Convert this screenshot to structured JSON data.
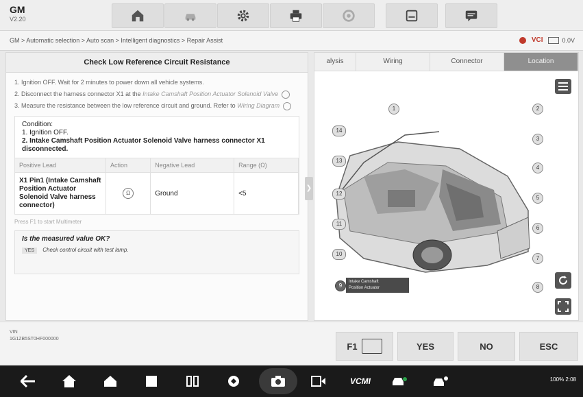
{
  "app": {
    "brand": "GM",
    "version": "V2.20"
  },
  "toolbar": {
    "icons": [
      "home-icon",
      "vehicle-icon",
      "gear-icon",
      "print-icon",
      "help-icon",
      "save-icon",
      "chat-icon"
    ]
  },
  "breadcrumb": {
    "text": "GM > Automatic selection > Auto scan > Intelligent diagnostics > Repair Assist"
  },
  "status_bar": {
    "vci_label": "VCI",
    "voltage": "0.0V"
  },
  "left": {
    "title": "Check Low Reference Circuit Resistance",
    "steps": [
      {
        "text": "1. Ignition OFF. Wait for 2 minutes to power down all vehicle systems."
      },
      {
        "text": "2. Disconnect the harness connector X1 at the",
        "link": "Intake Camshaft Position Actuator Solenoid Valve"
      },
      {
        "text": "3. Measure the resistance between the low reference circuit and ground. Refer to",
        "link": "Wiring Diagram"
      }
    ],
    "condition_label": "Condition:",
    "condition_1": "1. Ignition OFF.",
    "condition_2": "2. Intake Camshaft Position Actuator Solenoid Valve harness connector X1 disconnected.",
    "table": {
      "headers": [
        "Positive Lead",
        "Action",
        "Negative Lead",
        "Range (Ω)"
      ],
      "row": {
        "positive": "X1 Pin1 (Intake Camshaft Position Actuator Solenoid Valve harness connector)",
        "action": "Ω",
        "negative": "Ground",
        "range": "<5"
      }
    },
    "hint": "Press F1 to start Multimeter",
    "question": "Is the measured value OK?",
    "answer_tag": "YES",
    "answer_text": "Check control circuit with test lamp."
  },
  "right": {
    "tabs": [
      "alysis",
      "Wiring",
      "Connector",
      "Location"
    ],
    "active_tab": "Location",
    "callouts": [
      "1",
      "2",
      "3",
      "4",
      "5",
      "6",
      "7",
      "8",
      "9",
      "10",
      "11",
      "12",
      "13",
      "14"
    ],
    "component_label_1": "Intake Camshaft",
    "component_label_2": "Position Actuator"
  },
  "bottom": {
    "vin_label": "VIN",
    "vin_value": "1G1ZB5ST0HF000000",
    "buttons": {
      "f1": "F1",
      "yes": "YES",
      "no": "NO",
      "esc": "ESC"
    }
  },
  "navbar": {
    "vcm": "VCMI",
    "status": "100%  2:08"
  }
}
